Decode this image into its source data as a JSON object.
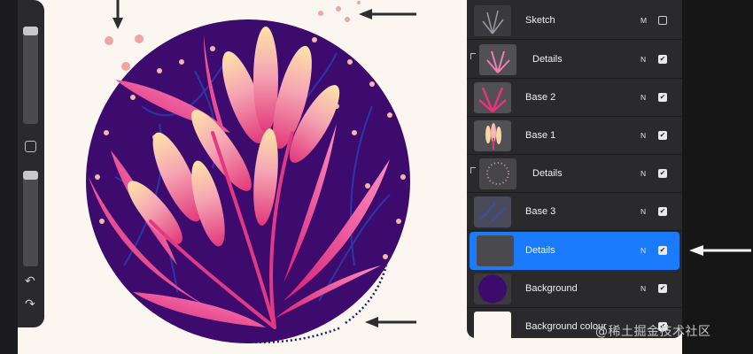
{
  "layers": [
    {
      "name": "Sketch",
      "blend": "M",
      "visible": false,
      "child": false
    },
    {
      "name": "Details",
      "blend": "N",
      "visible": true,
      "child": true
    },
    {
      "name": "Base 2",
      "blend": "N",
      "visible": true,
      "child": false
    },
    {
      "name": "Base 1",
      "blend": "N",
      "visible": true,
      "child": false
    },
    {
      "name": "Details",
      "blend": "N",
      "visible": true,
      "child": true
    },
    {
      "name": "Base 3",
      "blend": "N",
      "visible": true,
      "child": false
    },
    {
      "name": "Details",
      "blend": "N",
      "visible": true,
      "child": false,
      "selected": true
    },
    {
      "name": "Background",
      "blend": "N",
      "visible": true,
      "child": false
    },
    {
      "name": "Background colour",
      "blend": "",
      "visible": true,
      "child": false
    }
  ],
  "watermark": "@稀土掘金技术社区",
  "colors": {
    "canvas_bg": "#fbf6ef",
    "circle": "#3d0b6e",
    "accent_selected": "#1a7bfd",
    "pink": "#f0508c",
    "peach": "#fbd9a0"
  },
  "icons": {
    "undo": "undo-icon",
    "redo": "redo-icon"
  }
}
